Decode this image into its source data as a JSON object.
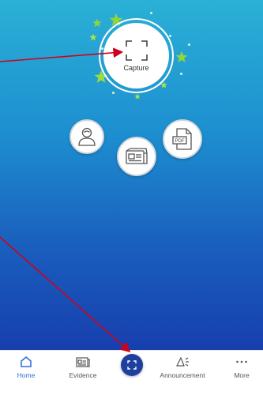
{
  "capture": {
    "label": "Capture",
    "icon": "capture-frame-icon"
  },
  "features": [
    {
      "icon": "profile-icon"
    },
    {
      "icon": "news-card-icon"
    },
    {
      "icon": "pdf-file-icon",
      "badge": "PDF"
    }
  ],
  "bottom_nav": {
    "items": [
      {
        "label": "Home",
        "icon": "home-icon",
        "active": true
      },
      {
        "label": "Evidence",
        "icon": "evidence-icon",
        "active": false
      },
      {
        "label": "Announcement",
        "icon": "announcement-icon",
        "active": false
      },
      {
        "label": "More",
        "icon": "more-icon",
        "active": false
      }
    ],
    "fab_icon": "scan-icon"
  },
  "colors": {
    "gradient_top": "#2ab0d6",
    "gradient_bottom": "#173fae",
    "accent": "#2f6fe0",
    "fab": "#1e3f9e",
    "annotation_arrow": "#d0021b",
    "star": "#8fd63a"
  }
}
